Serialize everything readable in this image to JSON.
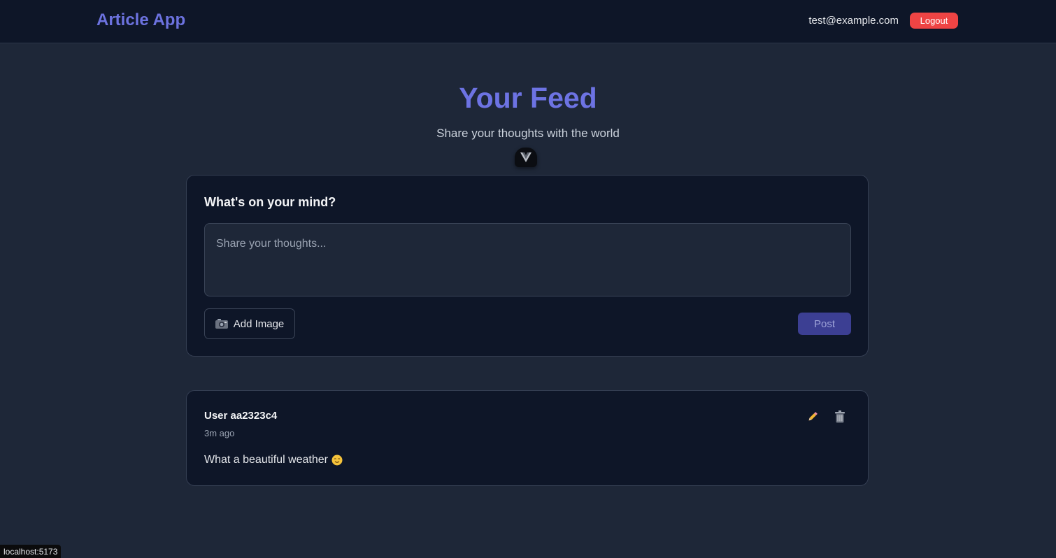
{
  "app": {
    "title": "Article App"
  },
  "header": {
    "user_email": "test@example.com",
    "logout_label": "Logout"
  },
  "page": {
    "title": "Your Feed",
    "subtitle": "Share your thoughts with the world"
  },
  "devtools": {
    "badge_icon": "vue-icon"
  },
  "composer": {
    "heading": "What's on your mind?",
    "placeholder": "Share your thoughts...",
    "value": "",
    "add_image_label": "Add Image",
    "add_image_icon": "camera-icon",
    "post_label": "Post"
  },
  "posts": [
    {
      "author": "User aa2323c4",
      "time": "3m ago",
      "content": "What a beautiful weather",
      "content_emoji": "smile-icon",
      "actions": [
        "edit-icon",
        "delete-icon"
      ]
    }
  ],
  "status_bar": {
    "url": "localhost:5173"
  },
  "colors": {
    "brand": "#6c72df",
    "logout": "#ef4444",
    "post_button": "#3c3f93",
    "page_background": "#1e2738",
    "card_background": "#0e1628"
  }
}
